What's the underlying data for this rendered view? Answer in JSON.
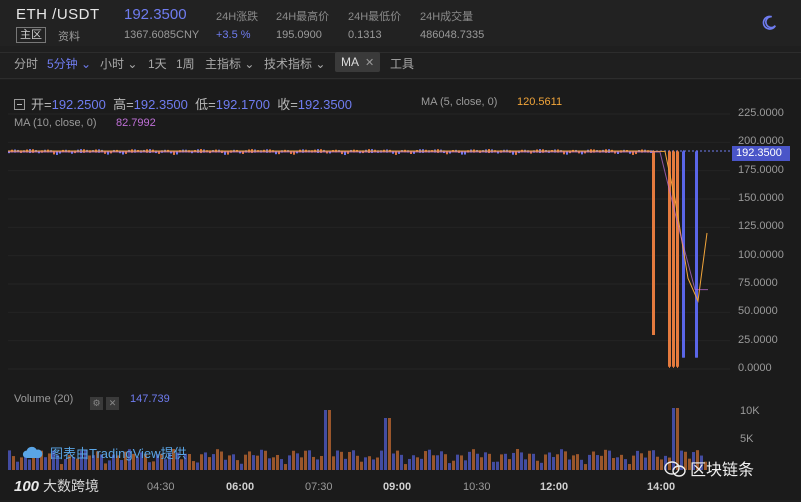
{
  "header": {
    "pair": "ETH /USDT",
    "price": "192.3500",
    "tag_main": "主区",
    "tag_info": "资料",
    "cny": "1367.6085CNY",
    "stats": [
      {
        "label": "24H涨跌",
        "value": "+3.5 %"
      },
      {
        "label": "24H最高价",
        "value": "195.0900"
      },
      {
        "label": "24H最低价",
        "value": "0.1313"
      },
      {
        "label": "24H成交量",
        "value": "486048.7335"
      }
    ]
  },
  "toolbar": {
    "items": [
      "分时",
      "5分钟",
      "小时",
      "1天",
      "1周",
      "主指标",
      "技术指标",
      "MA",
      "工具"
    ]
  },
  "legend": {
    "open_label": "开=",
    "open": "192.2500",
    "high_label": "高=",
    "high": "192.3500",
    "low_label": "低=",
    "low": "192.1700",
    "close_label": "收=",
    "close": "192.3500",
    "ma5_label": "MA (5, close, 0)",
    "ma5_value": "120.5611",
    "ma10_label": "MA (10, close, 0)",
    "ma10_value": "82.7992"
  },
  "price_label": "192.3500",
  "volume": {
    "label": "Volume (20)",
    "value": "147.739",
    "y_ticks": [
      "10K",
      "5K"
    ]
  },
  "credit": "图表由TradingView提供",
  "watermarks": {
    "left_logo": "100",
    "left_text": "大数跨境",
    "right_text": "区块链条"
  },
  "colors": {
    "accent": "#6f7cf0",
    "down": "#e47a3e",
    "ma5": "#f2a53a",
    "ma10": "#c070d8"
  },
  "chart_data": {
    "type": "candlestick",
    "y_ticks": [
      225,
      200,
      175,
      150,
      125,
      100,
      75,
      50,
      25,
      0
    ],
    "y_tick_labels": [
      "225.0000",
      "200.0000",
      "175.0000",
      "150.0000",
      "125.0000",
      "100.0000",
      "75.0000",
      "50.0000",
      "25.0000",
      "0.0000"
    ],
    "ylim": [
      0,
      225
    ],
    "x_ticks": [
      "04:30",
      "06:00",
      "07:30",
      "09:00",
      "10:30",
      "12:00",
      "14:00"
    ],
    "x_ticks_bold": [
      "06:00",
      "09:00",
      "12:00",
      "14:00"
    ],
    "flat_level": 192.3,
    "crash": [
      {
        "open": 192,
        "close": 30,
        "high": 193,
        "low": 30,
        "dir": "down"
      },
      {
        "open": 192,
        "close": 2,
        "high": 193,
        "low": 1,
        "dir": "down"
      },
      {
        "open": 192,
        "close": 2,
        "high": 193,
        "low": 1,
        "dir": "down"
      },
      {
        "open": 192,
        "close": 2,
        "high": 193,
        "low": 1,
        "dir": "down"
      },
      {
        "open": 10,
        "close": 192,
        "high": 193,
        "low": 10,
        "dir": "up"
      },
      {
        "open": 10,
        "close": 192,
        "high": 193,
        "low": 10,
        "dir": "up"
      }
    ],
    "ma5_tail": [
      192,
      192,
      150,
      80,
      60,
      120
    ],
    "volume_ylim": [
      0,
      12000
    ]
  }
}
